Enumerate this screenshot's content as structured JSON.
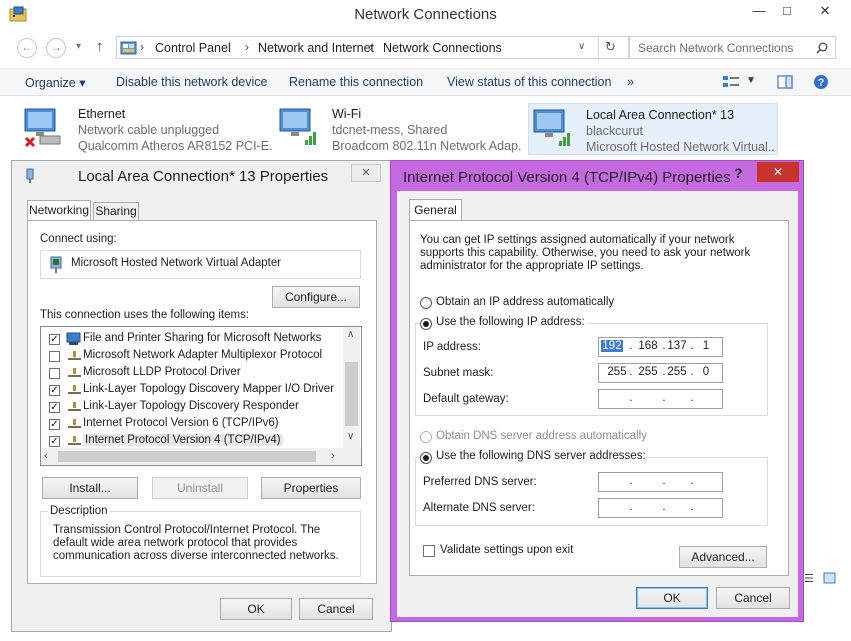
{
  "explorer": {
    "title": "Network Connections",
    "controls": {
      "minimize": "—",
      "maximize": "□",
      "close": "✕"
    },
    "breadcrumb": [
      "Control Panel",
      "Network and Internet",
      "Network Connections"
    ],
    "search_placeholder": "Search Network Connections",
    "commands": [
      "Organize ▾",
      "Disable this network device",
      "Rename this connection",
      "View status of this connection",
      "»"
    ],
    "connections": [
      {
        "name": "Ethernet",
        "status": "Network cable unplugged",
        "device": "Qualcomm Atheros AR8152 PCI-E..."
      },
      {
        "name": "Wi-Fi",
        "status": "tdcnet-mess, Shared",
        "device": "Broadcom 802.11n Network Adap..."
      },
      {
        "name": "Local Area Connection* 13",
        "status": "blackcurut",
        "device": "Microsoft Hosted Network Virtual..."
      }
    ]
  },
  "props_dialog": {
    "title": "Local Area Connection* 13 Properties",
    "close": "✕",
    "tabs": [
      "Networking",
      "Sharing"
    ],
    "connect_using_label": "Connect using:",
    "adapter": "Microsoft Hosted Network Virtual Adapter",
    "configure_button": "Configure...",
    "items_label": "This connection uses the following items:",
    "items": [
      {
        "label": "File and Printer Sharing for Microsoft Networks",
        "checked": true
      },
      {
        "label": "Microsoft Network Adapter Multiplexor Protocol",
        "checked": false
      },
      {
        "label": "Microsoft LLDP Protocol Driver",
        "checked": false
      },
      {
        "label": "Link-Layer Topology Discovery Mapper I/O Driver",
        "checked": true
      },
      {
        "label": "Link-Layer Topology Discovery Responder",
        "checked": true
      },
      {
        "label": "Internet Protocol Version 6 (TCP/IPv6)",
        "checked": true
      },
      {
        "label": "Internet Protocol Version 4 (TCP/IPv4)",
        "checked": true
      }
    ],
    "install_button": "Install...",
    "uninstall_button": "Uninstall",
    "properties_button": "Properties",
    "description_label": "Description",
    "description": "Transmission Control Protocol/Internet Protocol. The default wide area network protocol that provides communication across diverse interconnected networks.",
    "ok_button": "OK",
    "cancel_button": "Cancel"
  },
  "ipv4_dialog": {
    "title": "Internet Protocol Version 4 (TCP/IPv4) Properties",
    "help": "?",
    "close": "✕",
    "tab": "General",
    "intro": "You can get IP settings assigned automatically if your network supports this capability. Otherwise, you need to ask your network administrator for the appropriate IP settings.",
    "ip_auto": "Obtain an IP address automatically",
    "ip_manual": "Use the following IP address:",
    "ip_address_label": "IP address:",
    "ip_address": [
      "192",
      "168",
      "137",
      "1"
    ],
    "subnet_label": "Subnet mask:",
    "subnet": [
      "255",
      "255",
      "255",
      "0"
    ],
    "gateway_label": "Default gateway:",
    "dns_auto": "Obtain DNS server address automatically",
    "dns_manual": "Use the following DNS server addresses:",
    "preferred_dns_label": "Preferred DNS server:",
    "alternate_dns_label": "Alternate DNS server:",
    "validate_label": "Validate settings upon exit",
    "advanced_button": "Advanced...",
    "ok_button": "OK",
    "cancel_button": "Cancel",
    "dot": "."
  }
}
